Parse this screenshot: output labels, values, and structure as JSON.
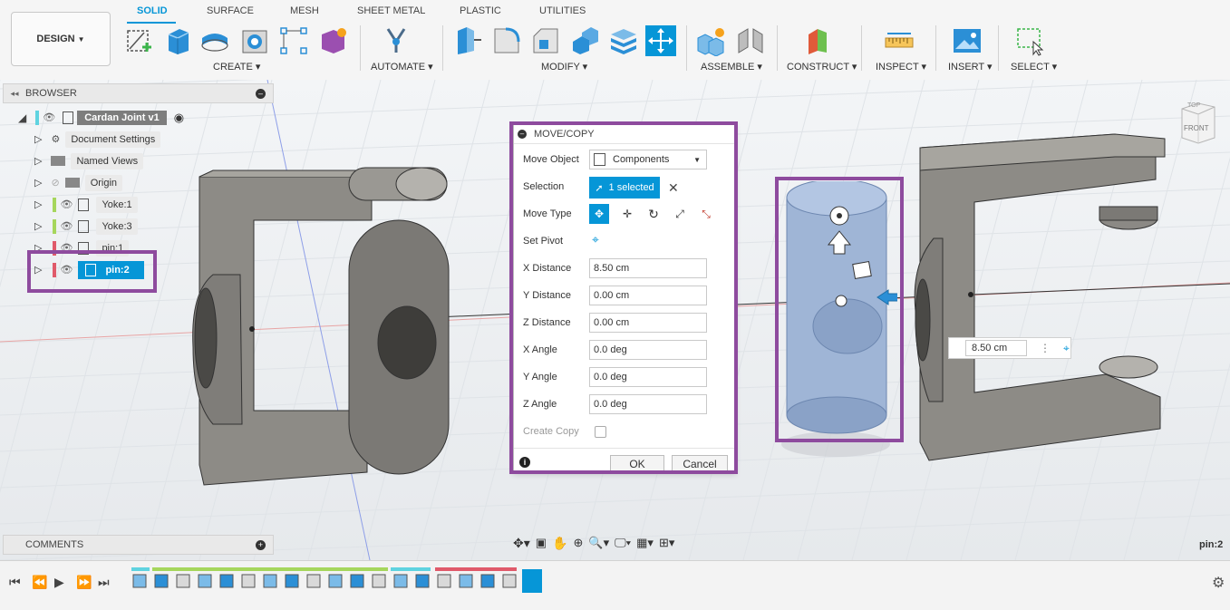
{
  "design_menu": "DESIGN",
  "tabs": [
    "SOLID",
    "SURFACE",
    "MESH",
    "SHEET METAL",
    "PLASTIC",
    "UTILITIES"
  ],
  "groups": [
    "CREATE",
    "AUTOMATE",
    "MODIFY",
    "ASSEMBLE",
    "CONSTRUCT",
    "INSPECT",
    "INSERT",
    "SELECT"
  ],
  "browser": {
    "title": "BROWSER",
    "root": "Cardan Joint v1",
    "items": [
      "Document Settings",
      "Named Views",
      "Origin",
      "Yoke:1",
      "Yoke:3",
      "pin:1",
      "pin:2"
    ],
    "selected": "pin:2"
  },
  "dialog": {
    "title": "MOVE/COPY",
    "move_object_label": "Move Object",
    "move_object_value": "Components",
    "selection_label": "Selection",
    "selection_value": "1 selected",
    "move_type_label": "Move Type",
    "set_pivot_label": "Set Pivot",
    "fields": [
      {
        "label": "X Distance",
        "value": "8.50 cm"
      },
      {
        "label": "Y Distance",
        "value": "0.00 cm"
      },
      {
        "label": "Z Distance",
        "value": "0.00 cm"
      },
      {
        "label": "X Angle",
        "value": "0.0 deg"
      },
      {
        "label": "Y Angle",
        "value": "0.0 deg"
      },
      {
        "label": "Z Angle",
        "value": "0.0 deg"
      }
    ],
    "create_copy_label": "Create Copy",
    "ok": "OK",
    "cancel": "Cancel"
  },
  "viewcube_label": "FRONT",
  "viewcube_top": "TOP",
  "distance_input": "8.50 cm",
  "comments_title": "COMMENTS",
  "status_selection": "pin:2",
  "colors": {
    "accent": "#0696d7",
    "highlight": "#8e4b9e",
    "yoke_green": "#a6d65c",
    "pin_red": "#e05a6a",
    "teal": "#5fd3e0"
  }
}
